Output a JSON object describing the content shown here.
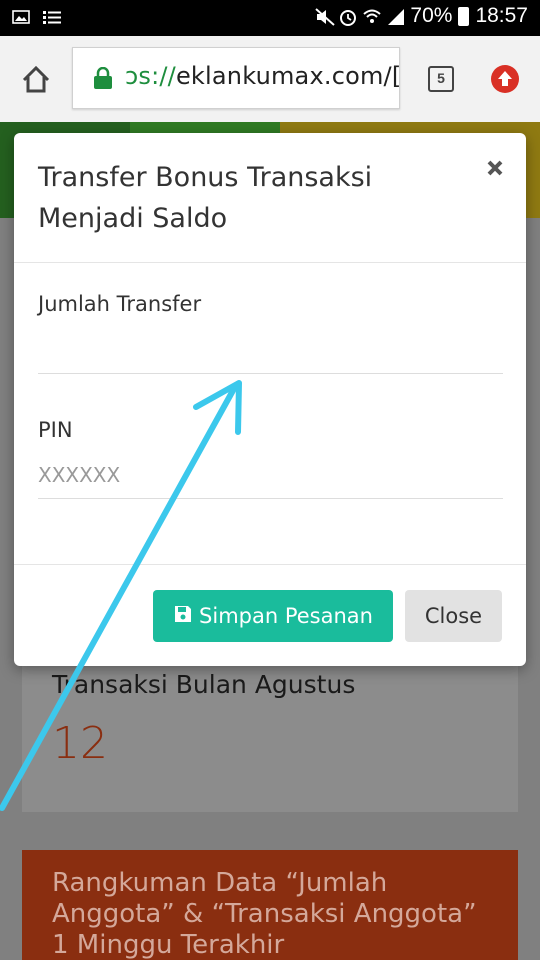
{
  "status_bar": {
    "battery": "70%",
    "time": "18:57"
  },
  "browser": {
    "url_scheme_fragment": "ɔs://",
    "url_rest": "eklankumax.com/[",
    "tab_count": "5"
  },
  "modal": {
    "title": "Transfer Bonus Transaksi Menjadi Saldo",
    "close_glyph": "×",
    "fields": [
      {
        "label": "Jumlah Transfer",
        "value": "",
        "placeholder": ""
      },
      {
        "label": "PIN",
        "value": "",
        "placeholder": "XXXXXX"
      }
    ],
    "save_label": "Simpan Pesanan",
    "close_label": "Close"
  },
  "background": {
    "month_card": {
      "title": "Transaksi Bulan Agustus",
      "count": "12"
    },
    "summary_card": {
      "title": "Rangkuman Data “Jumlah Anggota” & “Transaksi Anggota” 1 Minggu Terakhir"
    }
  },
  "colors": {
    "save_button": "#1abc9c",
    "annotation_arrow": "#3cc8ec",
    "summary_card": "#8a2e10",
    "url_scheme": "#1e8e3e"
  },
  "icons": {
    "home": "home-icon",
    "lock": "lock-icon",
    "tabs": "tab-switcher-icon",
    "upgrade": "upgrade-arrow-icon",
    "save": "floppy-disk-icon",
    "close": "close-icon"
  }
}
